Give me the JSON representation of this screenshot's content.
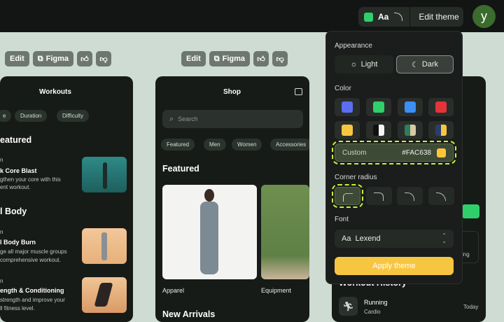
{
  "header": {
    "theme_swatch_color": "#2fd06b",
    "font_preview": "Aa",
    "edit_theme_label": "Edit theme",
    "avatar_initial": "y"
  },
  "toolbar": {
    "edit_label": "Edit",
    "figma_label": "Figma"
  },
  "workouts": {
    "title": "Workouts",
    "chips": [
      "e",
      "Duration",
      "Difficulty"
    ],
    "featured_heading": "eatured",
    "items": [
      {
        "tag": "n",
        "title": "k Core Blast",
        "desc1": "gthen your core with this",
        "desc2": "ent workout."
      },
      {
        "tag": "n",
        "title": "l Body Burn",
        "desc1": "ge all major muscle groups",
        "desc2": "comprehensive workout."
      },
      {
        "tag": "n",
        "title": "ength & Conditioning",
        "desc1": "strength and improve your",
        "desc2": "ll fitness level."
      }
    ],
    "section2_heading": "l Body"
  },
  "shop": {
    "title": "Shop",
    "search_placeholder": "Search",
    "chips": [
      "Featured",
      "Men",
      "Women",
      "Accessories"
    ],
    "featured_heading": "Featured",
    "products": [
      "Apparel",
      "Equipment"
    ],
    "new_arrivals_heading": "New Arrivals"
  },
  "right_card": {
    "history_heading": "Workout History",
    "entry_title": "Running",
    "entry_sub": "Cardio",
    "entry_time": "Today",
    "partial_text": "ing"
  },
  "panel": {
    "appearance_label": "Appearance",
    "light_label": "Light",
    "dark_label": "Dark",
    "color_label": "Color",
    "colors": [
      "#5b6ef0",
      "#2fd06b",
      "#3b8ff5",
      "#e5333a",
      "#f7c641"
    ],
    "custom_label": "Custom",
    "custom_value": "#FAC638",
    "custom_color": "#FAC638",
    "corner_radius_label": "Corner radius",
    "font_label": "Font",
    "font_preview": "Aa",
    "font_value": "Lexend",
    "apply_label": "Apply theme"
  }
}
